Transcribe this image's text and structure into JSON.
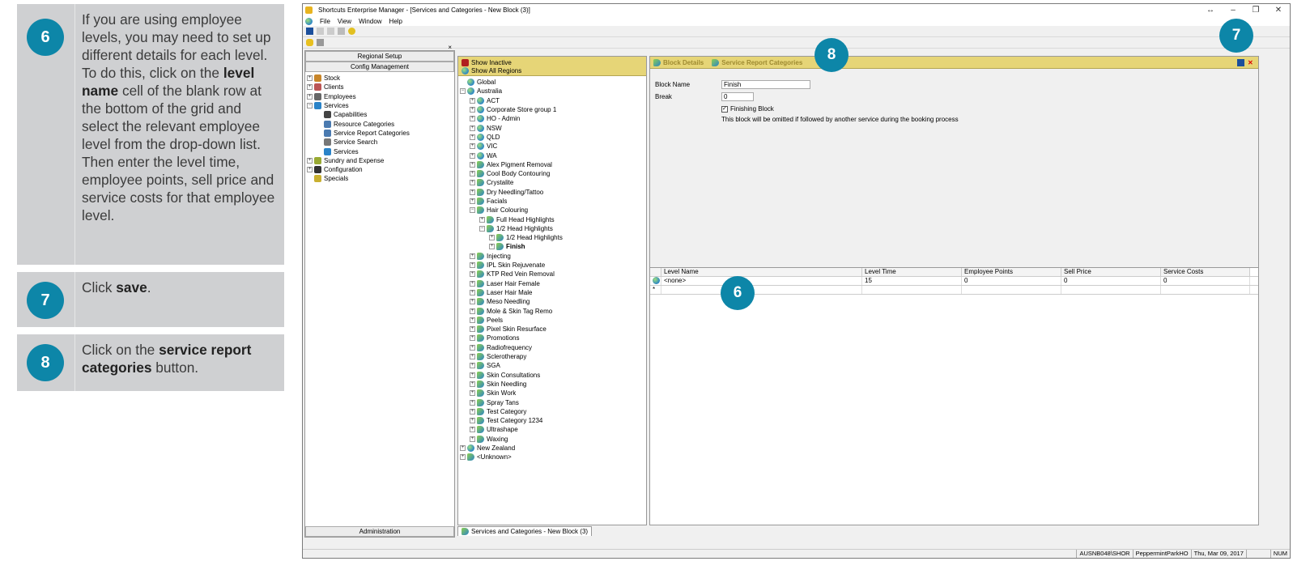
{
  "steps": [
    {
      "num": "6",
      "text_pre": "If you are using employee levels, you may need to set up different details for each level. To do this, click on the ",
      "bold": "level name",
      "text_post": " cell of the blank row at the bottom of the grid and select the relevant employee level from the drop-down list. Then enter the level time, employee points, sell price and service costs for that employee level."
    },
    {
      "num": "7",
      "text_pre": "Click ",
      "bold": "save",
      "text_post": "."
    },
    {
      "num": "8",
      "text_pre": "Click on the ",
      "bold": "service report categories",
      "text_post": " button."
    }
  ],
  "window": {
    "title": "Shortcuts Enterprise Manager - [Services and Categories - New Block (3)]",
    "controls": [
      "↔",
      "–",
      "❐",
      "✕"
    ],
    "menu": [
      "File",
      "View",
      "Window",
      "Help"
    ]
  },
  "nav": {
    "buttons": [
      "Regional Setup",
      "Config Management"
    ],
    "close": "×",
    "tree": [
      {
        "label": "Stock",
        "level": 0,
        "exp": "+"
      },
      {
        "label": "Clients",
        "level": 0,
        "exp": "+"
      },
      {
        "label": "Employees",
        "level": 0,
        "exp": "+"
      },
      {
        "label": "Services",
        "level": 0,
        "exp": "−"
      },
      {
        "label": "Capabilities",
        "level": 1,
        "exp": ""
      },
      {
        "label": "Resource Categories",
        "level": 1,
        "exp": ""
      },
      {
        "label": "Service Report Categories",
        "level": 1,
        "exp": ""
      },
      {
        "label": "Service Search",
        "level": 1,
        "exp": ""
      },
      {
        "label": "Services",
        "level": 1,
        "exp": ""
      },
      {
        "label": "Sundry and Expense",
        "level": 0,
        "exp": "+"
      },
      {
        "label": "Configuration",
        "level": 0,
        "exp": "+"
      },
      {
        "label": "Specials",
        "level": 0,
        "exp": ""
      }
    ],
    "bottom_button": "Administration"
  },
  "mid": {
    "header": [
      "Show Inactive",
      "Show All Regions"
    ],
    "tree": [
      {
        "label": "Global",
        "level": 0,
        "exp": "",
        "icon": "globe"
      },
      {
        "label": "Australia",
        "level": 0,
        "exp": "−",
        "icon": "globe"
      },
      {
        "label": "ACT",
        "level": 1,
        "exp": "+",
        "icon": "globe"
      },
      {
        "label": "Corporate Store group 1",
        "level": 1,
        "exp": "+",
        "icon": "globe"
      },
      {
        "label": "HO - Admin",
        "level": 1,
        "exp": "+",
        "icon": "globe"
      },
      {
        "label": "NSW",
        "level": 1,
        "exp": "+",
        "icon": "globe"
      },
      {
        "label": "QLD",
        "level": 1,
        "exp": "+",
        "icon": "globe"
      },
      {
        "label": "VIC",
        "level": 1,
        "exp": "+",
        "icon": "globe"
      },
      {
        "label": "WA",
        "level": 1,
        "exp": "+",
        "icon": "globe"
      },
      {
        "label": "Alex Pigment Removal",
        "level": 1,
        "exp": "+",
        "icon": "tag"
      },
      {
        "label": "Cool Body Contouring",
        "level": 1,
        "exp": "+",
        "icon": "tag"
      },
      {
        "label": "Crystalite",
        "level": 1,
        "exp": "+",
        "icon": "tag"
      },
      {
        "label": "Dry Needling/Tattoo",
        "level": 1,
        "exp": "+",
        "icon": "tag"
      },
      {
        "label": "Facials",
        "level": 1,
        "exp": "+",
        "icon": "tag"
      },
      {
        "label": "Hair Colouring",
        "level": 1,
        "exp": "−",
        "icon": "tag"
      },
      {
        "label": "Full Head Highlights",
        "level": 2,
        "exp": "+",
        "icon": "tag"
      },
      {
        "label": "1/2 Head Highlights",
        "level": 2,
        "exp": "−",
        "icon": "tag"
      },
      {
        "label": "1/2 Head Highlights",
        "level": 3,
        "exp": "+",
        "icon": "tag"
      },
      {
        "label": "Finish",
        "level": 3,
        "exp": "+",
        "icon": "tag",
        "bold": true
      },
      {
        "label": "Injecting",
        "level": 1,
        "exp": "+",
        "icon": "tag"
      },
      {
        "label": "IPL Skin Rejuvenate",
        "level": 1,
        "exp": "+",
        "icon": "tag"
      },
      {
        "label": "KTP Red Vein Removal",
        "level": 1,
        "exp": "+",
        "icon": "tag"
      },
      {
        "label": "Laser Hair Female",
        "level": 1,
        "exp": "+",
        "icon": "tag"
      },
      {
        "label": "Laser Hair Male",
        "level": 1,
        "exp": "+",
        "icon": "tag"
      },
      {
        "label": "Meso Needling",
        "level": 1,
        "exp": "+",
        "icon": "tag"
      },
      {
        "label": "Mole & Skin Tag Remo",
        "level": 1,
        "exp": "+",
        "icon": "tag"
      },
      {
        "label": "Peels",
        "level": 1,
        "exp": "+",
        "icon": "tag"
      },
      {
        "label": "Pixel Skin Resurface",
        "level": 1,
        "exp": "+",
        "icon": "tag"
      },
      {
        "label": "Promotions",
        "level": 1,
        "exp": "+",
        "icon": "tag"
      },
      {
        "label": "Radiofrequency",
        "level": 1,
        "exp": "+",
        "icon": "tag"
      },
      {
        "label": "Sclerotherapy",
        "level": 1,
        "exp": "+",
        "icon": "tag"
      },
      {
        "label": "SGA",
        "level": 1,
        "exp": "+",
        "icon": "tag"
      },
      {
        "label": "Skin Consultations",
        "level": 1,
        "exp": "+",
        "icon": "tag"
      },
      {
        "label": "Skin Needling",
        "level": 1,
        "exp": "+",
        "icon": "tag"
      },
      {
        "label": "Skin Work",
        "level": 1,
        "exp": "+",
        "icon": "tag"
      },
      {
        "label": "Spray Tans",
        "level": 1,
        "exp": "+",
        "icon": "tag"
      },
      {
        "label": "Test Category",
        "level": 1,
        "exp": "+",
        "icon": "tag"
      },
      {
        "label": "Test Category 1234",
        "level": 1,
        "exp": "+",
        "icon": "tag"
      },
      {
        "label": "Ultrashape",
        "level": 1,
        "exp": "+",
        "icon": "tag"
      },
      {
        "label": "Waxing",
        "level": 1,
        "exp": "+",
        "icon": "tag"
      },
      {
        "label": "New Zealand",
        "level": 0,
        "exp": "+",
        "icon": "globe"
      },
      {
        "label": "<Unknown>",
        "level": 0,
        "exp": "+",
        "icon": "tag"
      }
    ]
  },
  "detail": {
    "tabs": [
      "Block Details",
      "Service Report Categories"
    ],
    "block_name_label": "Block Name",
    "block_name_value": "Finish",
    "break_label": "Break",
    "break_value": "0",
    "finishing_label": "Finishing Block",
    "note": "This block will be omitted if followed by another service during the booking process",
    "grid": {
      "headers": [
        "Level Name",
        "Level Time",
        "Employee Points",
        "Sell Price",
        "Service Costs"
      ],
      "row": [
        "<none>",
        "15",
        "0",
        "0",
        "0"
      ],
      "new_row_marker": "*"
    }
  },
  "doc_tab": "Services and Categories - New Block (3)",
  "status": [
    "AUSNB048\\SHOR",
    "PeppermintParkHO",
    "Thu, Mar 09, 2017",
    "",
    "NUM"
  ],
  "callouts": {
    "c6": "6",
    "c7": "7",
    "c8": "8"
  },
  "colors": {
    "accent": "#0d86a8",
    "header_yellow": "#e6d577"
  }
}
